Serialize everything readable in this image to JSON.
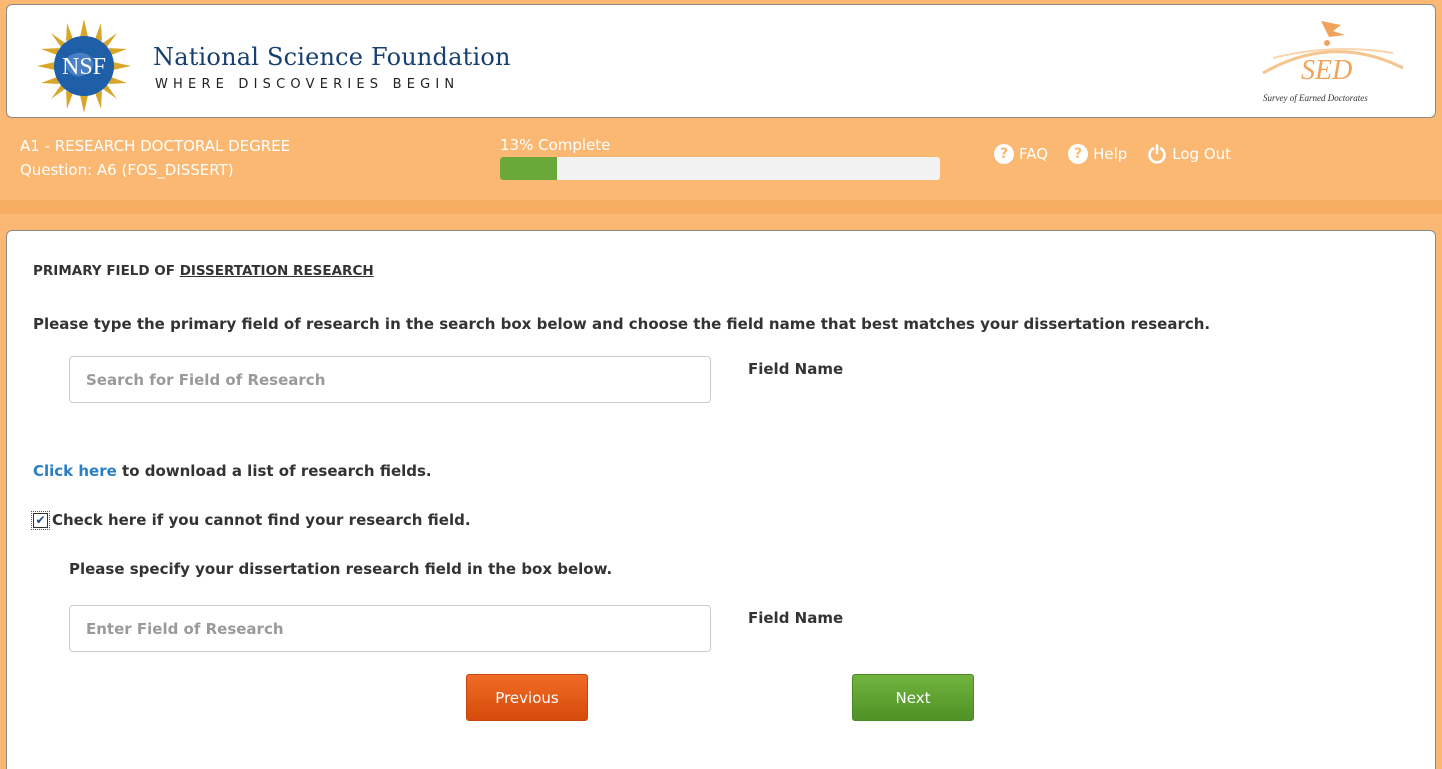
{
  "header": {
    "org_name": "National Science Foundation",
    "tagline": "WHERE DISCOVERIES BEGIN",
    "nsf_logo_text": "NSF",
    "sed_logo_text": "SED",
    "sed_logo_subtitle": "Survey of Earned Doctorates"
  },
  "status": {
    "section": "A1 - RESEARCH DOCTORAL DEGREE",
    "question": "Question: A6 (FOS_DISSERT)",
    "progress_label": "13% Complete",
    "progress_percent": 13
  },
  "nav": {
    "faq": "FAQ",
    "help": "Help",
    "logout": "Log Out"
  },
  "form": {
    "title_plain": "PRIMARY FIELD OF ",
    "title_underlined": "DISSERTATION RESEARCH",
    "instructions": "Please type the primary field of research in the search box below and choose the field name that best matches your dissertation research.",
    "search_placeholder": "Search for Field of Research",
    "field_name_label": "Field Name",
    "download_link": "Click here",
    "download_text": " to download a list of research fields.",
    "cannot_find_label": "Check here if you cannot find your research field.",
    "cannot_find_checked": true,
    "specify_text": "Please specify your dissertation research field in the box below.",
    "enter_placeholder": "Enter Field of Research",
    "field_name_label_2": "Field Name"
  },
  "buttons": {
    "previous": "Previous",
    "next": "Next"
  },
  "colors": {
    "page_bg": "#fbb872",
    "progress_fill": "#6aa83a",
    "previous_button": "#e8601a",
    "next_button": "#62a532",
    "link": "#2a7fc4",
    "title_text": "#173f6f"
  }
}
